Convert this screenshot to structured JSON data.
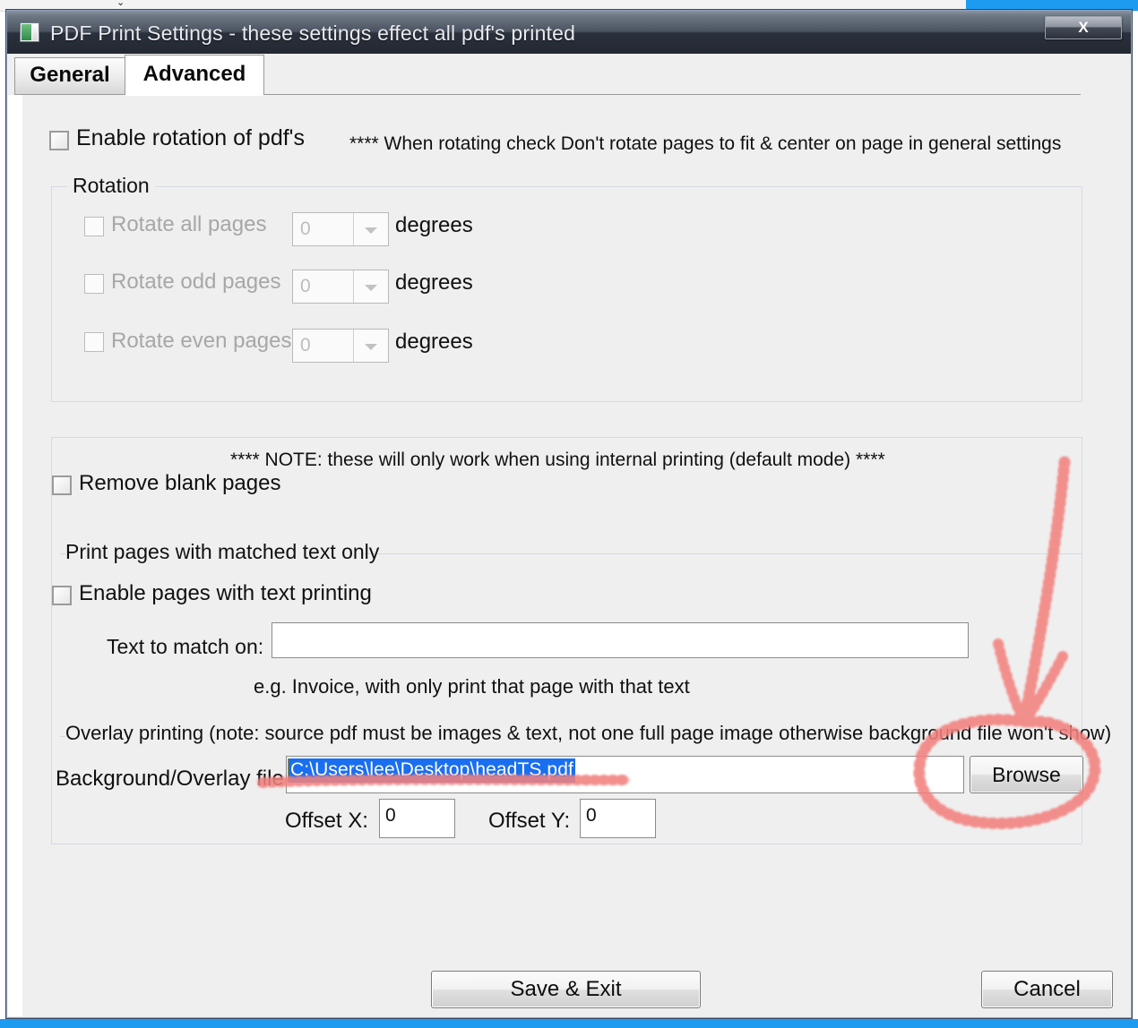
{
  "window": {
    "title": "PDF Print Settings - these settings effect all pdf's printed",
    "icon": "pdf-document-icon",
    "close_label": "X"
  },
  "tabs": [
    {
      "label": "General",
      "active": false
    },
    {
      "label": "Advanced",
      "active": true
    }
  ],
  "rotation_section": {
    "enable_checkbox_label": "Enable rotation of pdf's",
    "enable_checked": false,
    "note": "**** When rotating check Don't rotate pages to fit & center on page in general settings",
    "group_label": "Rotation",
    "rows": [
      {
        "label": "Rotate all pages",
        "value": "0",
        "unit": "degrees",
        "checked": false,
        "disabled": true
      },
      {
        "label": "Rotate odd pages",
        "value": "0",
        "unit": "degrees",
        "checked": false,
        "disabled": true
      },
      {
        "label": "Rotate even pages",
        "value": "0",
        "unit": "degrees",
        "checked": false,
        "disabled": true
      }
    ]
  },
  "internal_section": {
    "note": "**** NOTE: these will only work when using internal printing (default mode) ****",
    "remove_blank_label": "Remove blank pages",
    "remove_blank_checked": false,
    "match_group_label": "Print pages with matched text only",
    "enable_text_printing_label": "Enable pages with text printing",
    "enable_text_printing_checked": false,
    "text_to_match_label": "Text to match on:",
    "text_to_match_value": "",
    "text_to_match_hint": "e.g. Invoice,   with only print that page with that text"
  },
  "overlay_section": {
    "group_label": "Overlay printing (note: source pdf must be images & text, not one full page image otherwise background file won't show)",
    "file_label": "Background/Overlay file:",
    "file_value": "C:\\Users\\lee\\Desktop\\headTS.pdf",
    "file_selected": true,
    "browse_label": "Browse",
    "offset_x_label": "Offset X:",
    "offset_x_value": "0",
    "offset_y_label": "Offset Y:",
    "offset_y_value": "0"
  },
  "footer": {
    "save_label": "Save & Exit",
    "cancel_label": "Cancel"
  },
  "annotation": {
    "type": "red-marker-arrow-and-circle",
    "color": "#f08080",
    "targets": [
      "browse-button",
      "background-overlay-file-input"
    ]
  }
}
